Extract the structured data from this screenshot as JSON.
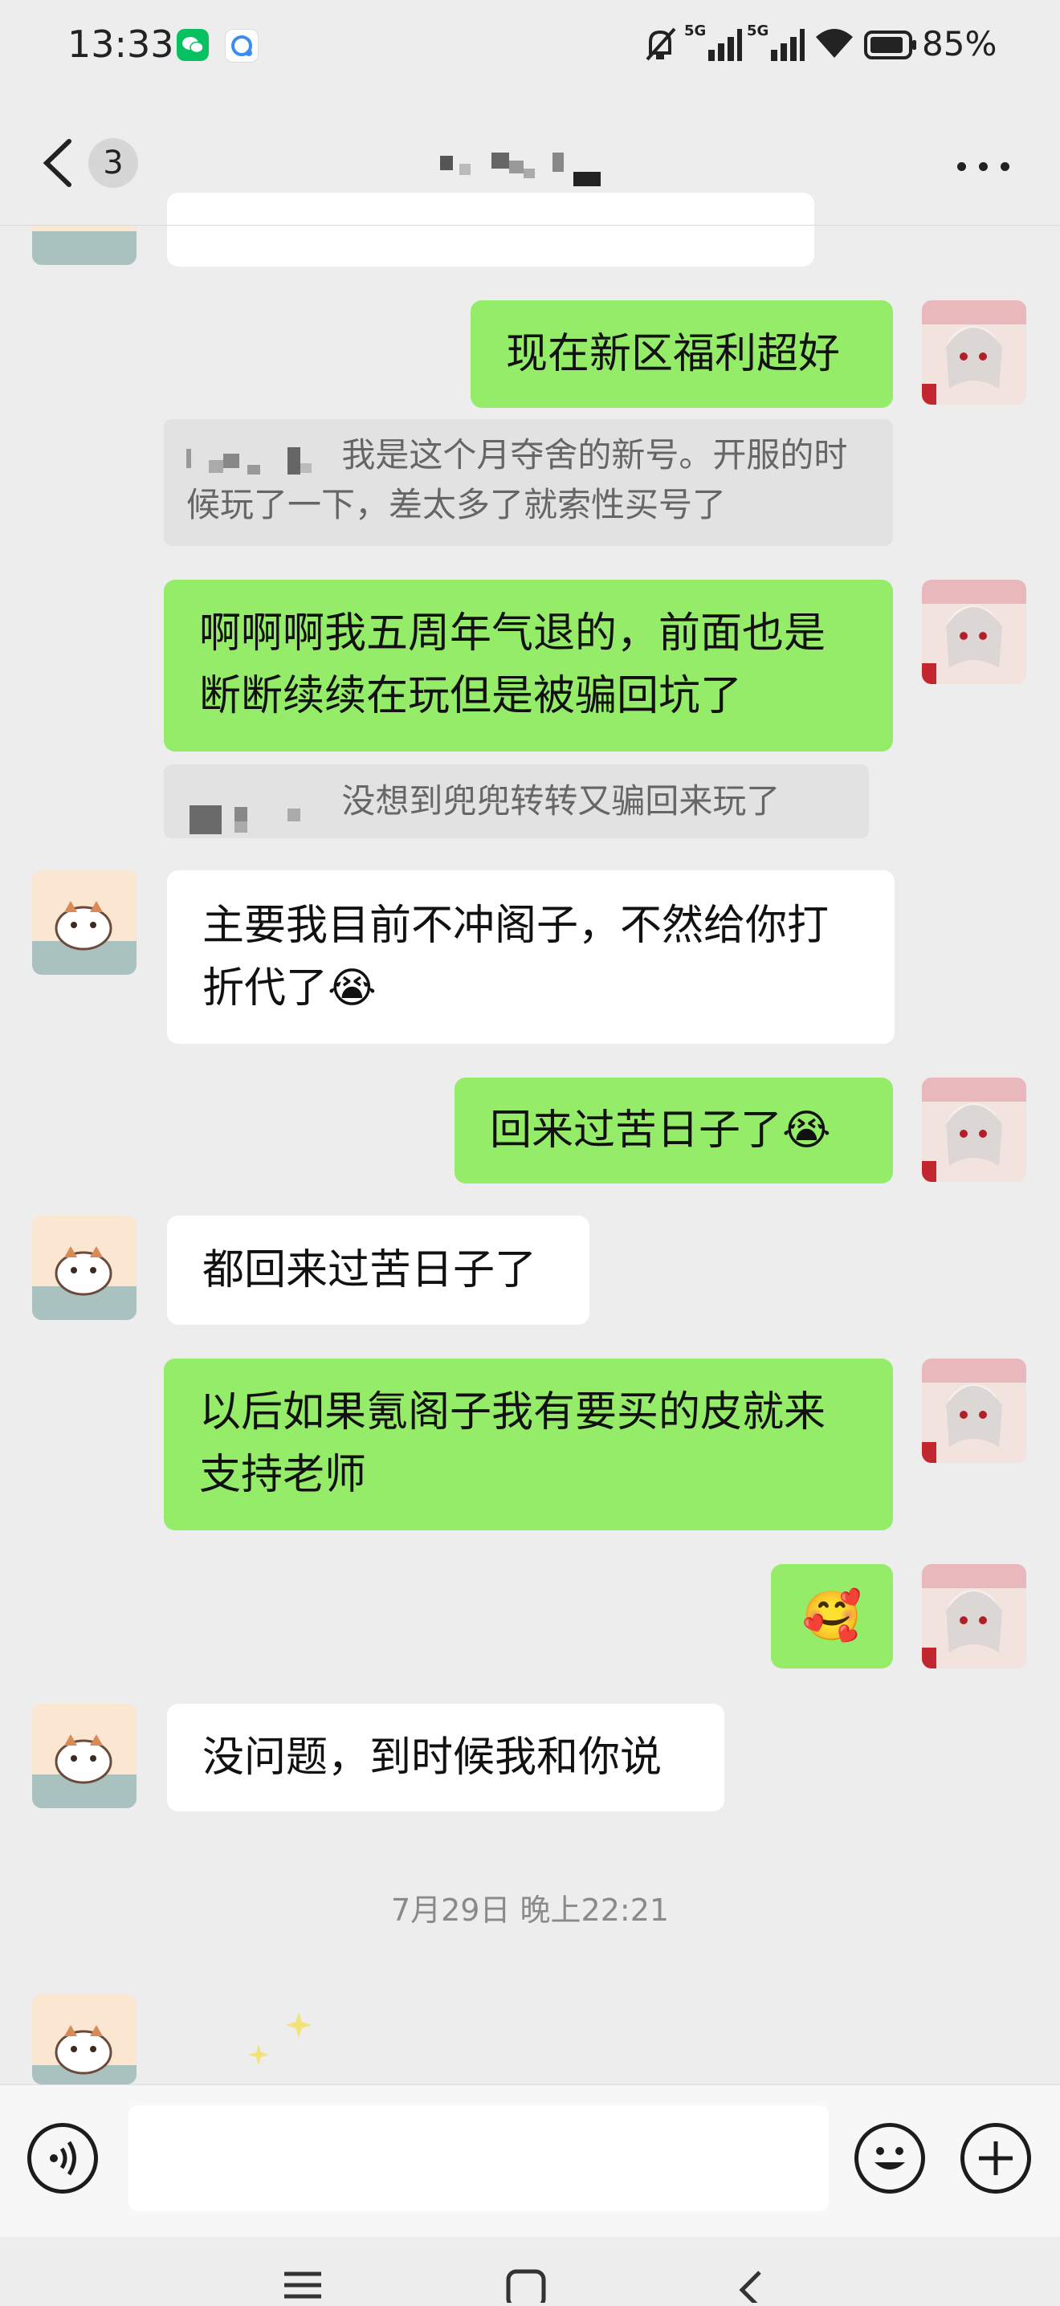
{
  "status_bar": {
    "time": "13:33",
    "battery_pct": "85%",
    "network_1": "5G",
    "network_2": "5G"
  },
  "title_bar": {
    "unread_count": "3"
  },
  "messages": {
    "m1": "现在新区福利超好",
    "q1": "我是这个月夺舍的新号。开服的时候玩了一下，差太多了就索性买号了",
    "m2": "啊啊啊我五周年气退的，前面也是断断续续在玩但是被骗回坑了",
    "q2": "没想到兜兜转转又骗回来玩了",
    "m3": "主要我目前不冲阁子，不然给你打折代了",
    "m4": "回来过苦日子了",
    "m5": "都回来过苦日子了",
    "m6": "以后如果氪阁子我有要买的皮就来支持老师",
    "m7": "🥰",
    "m8": "没问题，到时候我和你说",
    "crying_emoji": "😭"
  },
  "timestamp": "7月29日 晚上22:21",
  "colors": {
    "my_bubble": "#95ec69",
    "their_bubble": "#ffffff",
    "background": "#ededed"
  }
}
